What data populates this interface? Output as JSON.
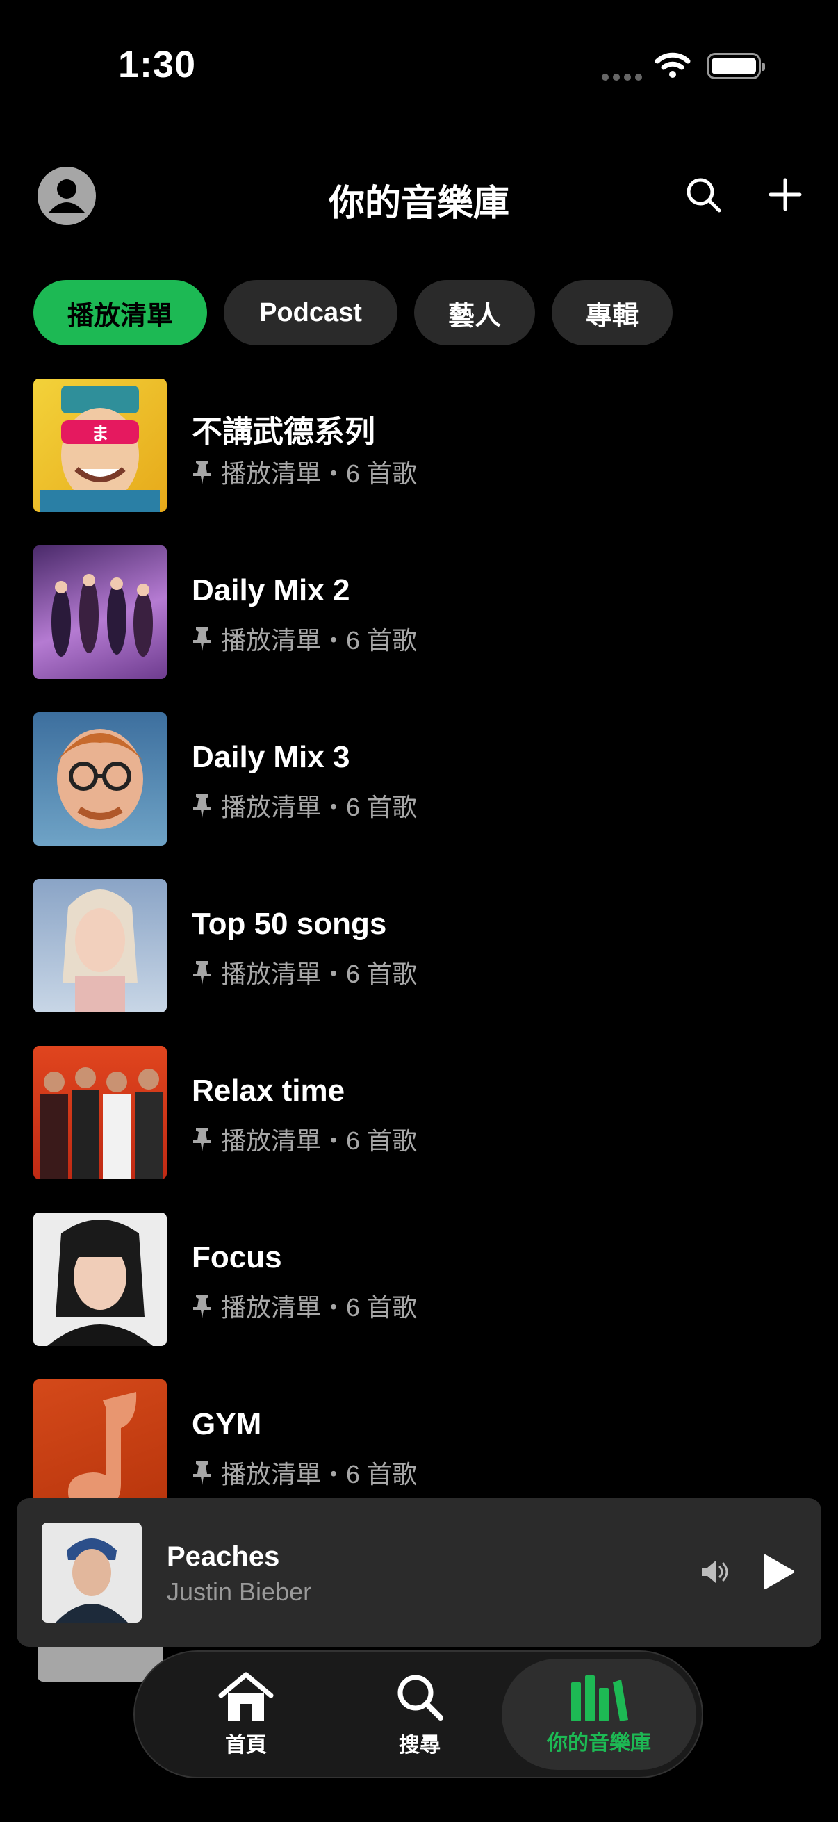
{
  "status": {
    "time": "1:30"
  },
  "header": {
    "title": "你的音樂庫"
  },
  "filters": [
    {
      "label": "播放清單",
      "active": true
    },
    {
      "label": "Podcast",
      "active": false
    },
    {
      "label": "藝人",
      "active": false
    },
    {
      "label": "專輯",
      "active": false
    }
  ],
  "playlists": [
    {
      "name": "不講武德系列",
      "meta": "播放清單・6 首歌"
    },
    {
      "name": "Daily Mix 2",
      "meta": "播放清單・6 首歌"
    },
    {
      "name": "Daily Mix 3",
      "meta": "播放清單・6 首歌"
    },
    {
      "name": "Top 50 songs",
      "meta": "播放清單・6 首歌"
    },
    {
      "name": "Relax time",
      "meta": "播放清單・6 首歌"
    },
    {
      "name": "Focus",
      "meta": "播放清單・6 首歌"
    },
    {
      "name": "GYM",
      "meta": "播放清單・6 首歌"
    }
  ],
  "now_playing": {
    "title": "Peaches",
    "artist": "Justin Bieber"
  },
  "tabs": [
    {
      "label": "首頁",
      "icon": "home-icon"
    },
    {
      "label": "搜尋",
      "icon": "search-icon"
    },
    {
      "label": "你的音樂庫",
      "icon": "library-icon"
    }
  ],
  "colors": {
    "accent": "#1db954",
    "chip_bg": "#2a2a2a",
    "player_bg": "#2b2b2b",
    "muted_text": "#a7a7a7"
  }
}
